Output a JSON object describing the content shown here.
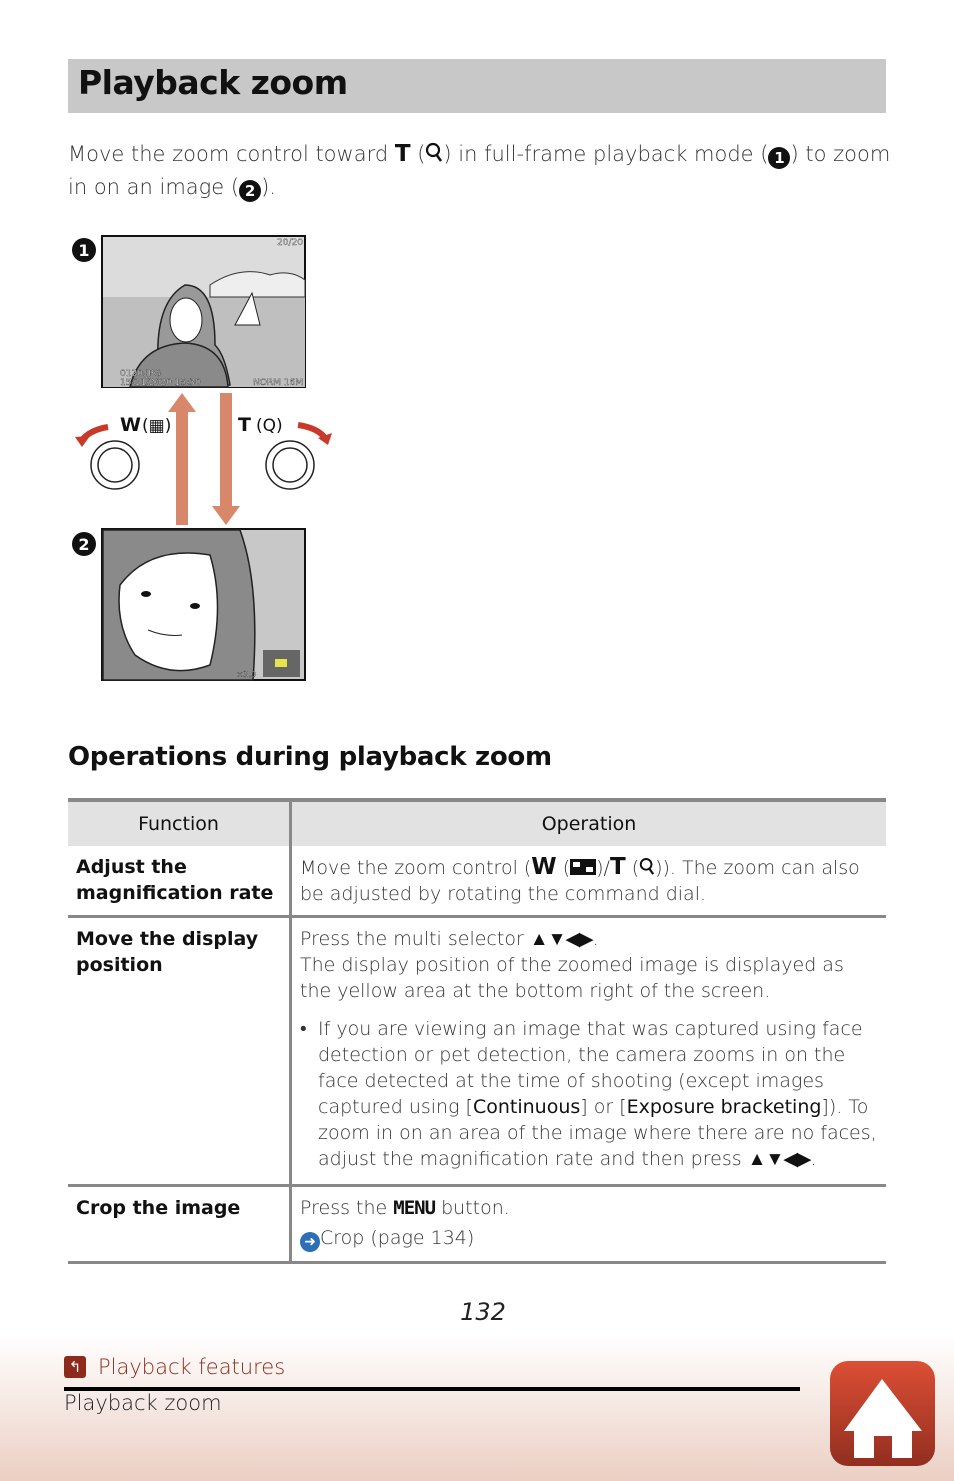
{
  "title": "Playback zoom",
  "intro": {
    "p1": "Move the zoom control toward ",
    "t": "T",
    "p2": " (",
    "p3": ") in full-frame playback mode (",
    "c1": "1",
    "p4": ") to zoom in on an image (",
    "c2": "2",
    "p5": ")."
  },
  "illustration": {
    "step1": "1",
    "step2": "2",
    "w_label": "W",
    "t_label": "T",
    "counter": "20/20",
    "filename": "0120.JPG",
    "datetime": "15/11/2020 15:30",
    "quality": "NORM 16M",
    "zoom_ratio": "×3.0",
    "arrow_color": "#d8886a",
    "rotate_color": "#c9392a",
    "position_marker_color": "#e6e64a"
  },
  "section_heading": "Operations during playback zoom",
  "table": {
    "headers": [
      "Function",
      "Operation"
    ],
    "rows": [
      {
        "function": "Adjust the magnification rate",
        "op1": "Move the zoom control (",
        "w": "W",
        "op2": " (",
        "op3": ")/",
        "t": "T",
        "op4": " (",
        "op5": ")). The zoom can also be adjusted by rotating the command dial."
      },
      {
        "function": "Move the display position",
        "op1": "Press the multi selector ",
        "arrows": "▲▼◀▶",
        "op2": ".",
        "op3": "The display position of the zoomed image is displayed as the yellow area at the bottom right of the screen.",
        "bullet": "•",
        "n1": "If you are viewing an image that was captured using face detection or pet detection, the camera zooms in on the face detected at the time of shooting (except images captured using [",
        "b1": "Continuous",
        "n2": "] or [",
        "b2": "Exposure bracketing",
        "n3": "]). To zoom in on an area of the image where there are no faces, adjust the magnification rate and then press ",
        "n4": "."
      },
      {
        "function": "Crop the image",
        "op1": "Press the ",
        "menu": "MENU",
        "op2": " button.",
        "link": "Crop (page 134)"
      }
    ]
  },
  "page_number": "132",
  "footer": {
    "section": "Playback features",
    "current": "Playback zoom",
    "accent": "#8c2a1c"
  }
}
